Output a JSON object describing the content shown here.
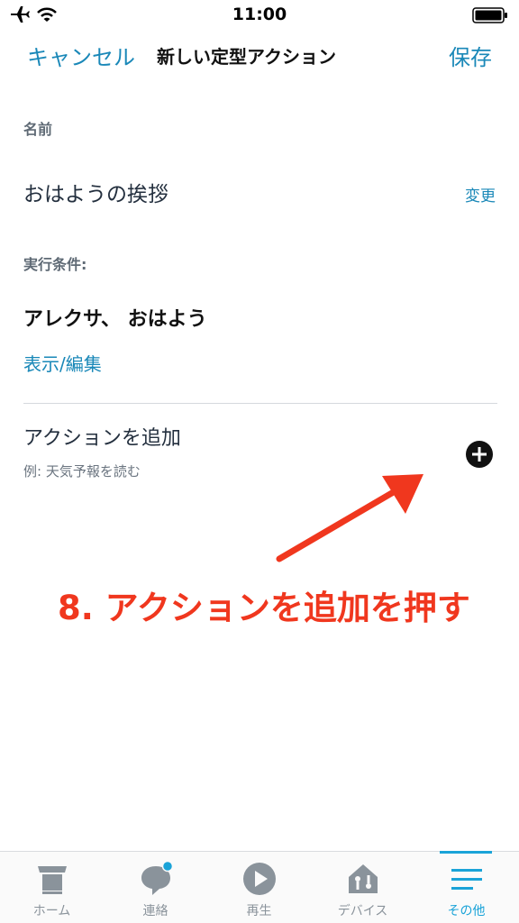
{
  "status_bar": {
    "time": "11:00"
  },
  "nav": {
    "cancel_label": "キャンセル",
    "title": "新しい定型アクション",
    "save_label": "保存"
  },
  "name_section": {
    "label": "名前",
    "value": "おはようの挨拶",
    "change_label": "変更"
  },
  "trigger_section": {
    "label": "実行条件:",
    "value": "アレクサ、 おはよう",
    "edit_label": "表示/編集"
  },
  "action_section": {
    "title": "アクションを追加",
    "hint": "例: 天気予報を読む"
  },
  "annotation": {
    "text": "8. アクションを追加を押す",
    "color": "#f0371e"
  },
  "tabs": [
    {
      "label": "ホーム",
      "icon": "home-icon"
    },
    {
      "label": "連絡",
      "icon": "chat-icon"
    },
    {
      "label": "再生",
      "icon": "play-icon"
    },
    {
      "label": "デバイス",
      "icon": "devices-icon"
    },
    {
      "label": "その他",
      "icon": "menu-icon",
      "active": true
    }
  ],
  "colors": {
    "link": "#1a88b8",
    "tab_active": "#1aa3d8",
    "tab_inactive": "#8a939b",
    "badge": "#1aa3d8"
  }
}
